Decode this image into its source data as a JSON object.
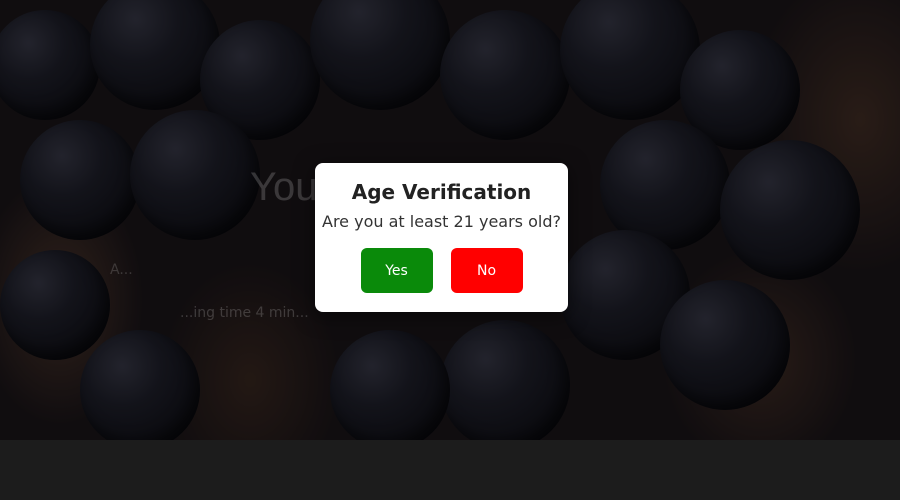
{
  "background": {
    "title": "You... ing",
    "meta": "A...",
    "reading": "...ing time 4 min..."
  },
  "modal": {
    "title": "Age Verification",
    "question": "Are you at least 21 years old?",
    "yes_label": "Yes",
    "no_label": "No"
  },
  "colors": {
    "yes_button": "#0a8a0a",
    "no_button": "#ff0000",
    "overlay": "#000000",
    "footer": "#1c1c1c"
  }
}
